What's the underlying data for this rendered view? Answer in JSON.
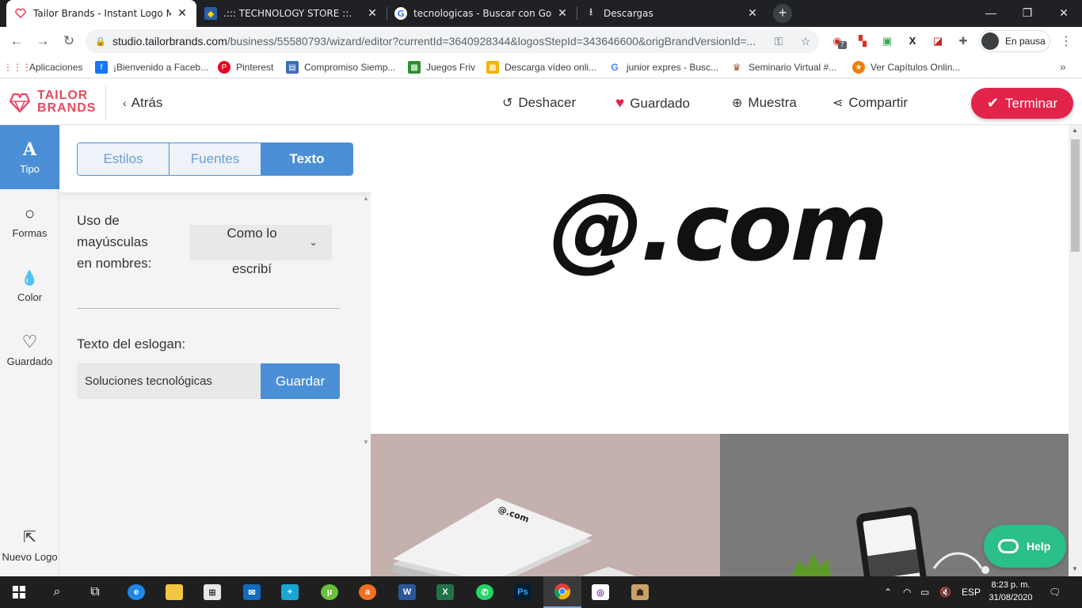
{
  "browser": {
    "tabs": [
      {
        "title": "Tailor Brands - Instant Logo Mak",
        "active": true
      },
      {
        "title": ".::: TECHNOLOGY STORE ::.",
        "active": false
      },
      {
        "title": "tecnologicas - Buscar con Googl",
        "active": false
      },
      {
        "title": "Descargas",
        "active": false
      }
    ],
    "url_host": "studio.tailorbrands.com",
    "url_path": "/business/55580793/wizard/editor?currentId=3640928344&logosStepId=343646600&origBrandVersionId=...",
    "extension_badge": "7",
    "profile_label": "En pausa",
    "bookmarks": [
      "Aplicaciones",
      "¡Bienvenido a Faceb...",
      "Pinterest",
      "Compromiso Siemp...",
      "Juegos Friv",
      "Descarga vídeo onli...",
      "junior expres - Busc...",
      "Seminario Virtual #...",
      "Ver Capítulos Onlin..."
    ]
  },
  "app": {
    "logo_line1": "TAILOR",
    "logo_line2": "BRANDS",
    "back_label": "Atrás",
    "actions": {
      "undo": "Deshacer",
      "saved": "Guardado",
      "preview": "Muestra",
      "share": "Compartir",
      "finish": "Terminar"
    },
    "rail": [
      {
        "label": "Tipo",
        "icon": "A",
        "active": true
      },
      {
        "label": "Formas",
        "icon": "circle",
        "active": false
      },
      {
        "label": "Color",
        "icon": "drop",
        "active": false
      },
      {
        "label": "Guardado",
        "icon": "heart",
        "active": false
      },
      {
        "label": "Nuevo Logo",
        "icon": "export",
        "active": false
      }
    ],
    "panel": {
      "tabs": [
        "Estilos",
        "Fuentes",
        "Texto"
      ],
      "active_tab": "Texto",
      "caps_label_1": "Uso de",
      "caps_label_2": "mayúsculas",
      "caps_label_3": "en nombres:",
      "caps_value_1": "Como lo",
      "caps_value_2": "escribí",
      "slogan_label": "Texto del eslogan:",
      "slogan_value": "Soluciones tecnológicas",
      "slogan_save": "Guardar"
    },
    "canvas": {
      "logo_text": "@.com"
    },
    "help_label": "Help"
  },
  "taskbar": {
    "language": "ESP",
    "time": "8:23 p. m.",
    "date": "31/08/2020"
  },
  "colors": {
    "brand_red": "#e2234a",
    "accent_blue": "#4b8fd6",
    "help_green": "#2bbf8a"
  }
}
